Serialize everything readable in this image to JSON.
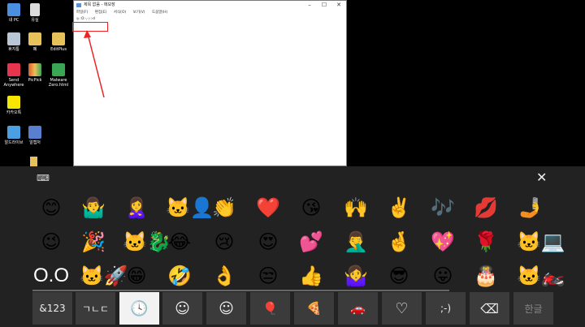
{
  "desktop": {
    "icons": [
      {
        "label": "내 PC",
        "color": "#4a8fe0"
      },
      {
        "label": "유실",
        "color": "#e7c25a"
      },
      {
        "label": "휴지통",
        "color": "#cccccc"
      },
      {
        "label": "폐",
        "color": "#e7c25a"
      },
      {
        "label": "EditPlus",
        "color": "#e7c25a"
      },
      {
        "label": "Send Anywhere",
        "color": "#e8354e"
      },
      {
        "label": "PicPick",
        "color": "#e05a2a"
      },
      {
        "label": "Malware Zero.html",
        "color": "#3aa655"
      },
      {
        "label": "카카오톡",
        "color": "#f7e600"
      },
      {
        "label": "알드라이브",
        "color": "#4aa0e0"
      },
      {
        "label": "알캡처",
        "color": "#5a7fd0"
      }
    ]
  },
  "notepad": {
    "title": "제목 없음 - 메모장",
    "menu": [
      "파일(F)",
      "편집(E)",
      "서식(O)",
      "보기(V)",
      "도움말(H)"
    ],
    "text": "◎ :O:-,-;-;-d"
  },
  "keyboard": {
    "keyboard_icon": "keyboard-settings-icon",
    "close": "✕",
    "emoji_rows": [
      [
        "😊",
        "🤷‍♂️",
        "🙎‍♀️",
        "🐱‍👤",
        "👏",
        "❤️",
        "😘",
        "🙌",
        "✌️",
        "🎶",
        "💋",
        "🤳"
      ],
      [
        "😉",
        "🎉",
        "🐱‍🐉",
        "😂",
        "😢",
        "😍",
        "💕",
        "🤦‍♂️",
        "🤞",
        "💖",
        "🌹",
        "🐱‍💻"
      ],
      [
        "O.O",
        "🐱‍🚀",
        "😁",
        "🤣",
        "👌",
        "😒",
        "👍",
        "🤷‍♀️",
        "😎",
        "😛",
        "🎂",
        "🐱‍🏍"
      ]
    ],
    "bottom_keys": [
      {
        "label": "&123",
        "name": "numbers-key"
      },
      {
        "label": "ㄱㄴㄷ",
        "name": "hangul-letters-key"
      },
      {
        "label": "🕓",
        "name": "recent-tab-clock-icon"
      },
      {
        "label": "☺",
        "name": "smileys-tab-icon"
      },
      {
        "label": "☺",
        "name": "people-tab-icon"
      },
      {
        "label": "🎈",
        "name": "celebration-tab-balloon-icon"
      },
      {
        "label": "🍕",
        "name": "food-tab-pizza-icon"
      },
      {
        "label": "🚗",
        "name": "travel-tab-car-icon"
      },
      {
        "label": "♡",
        "name": "symbols-tab-heart-icon"
      },
      {
        "label": ";-)",
        "name": "emoticons-tab"
      },
      {
        "label": "⌫",
        "name": "backspace-key"
      },
      {
        "label": "한글",
        "name": "hangul-language-key"
      }
    ]
  }
}
